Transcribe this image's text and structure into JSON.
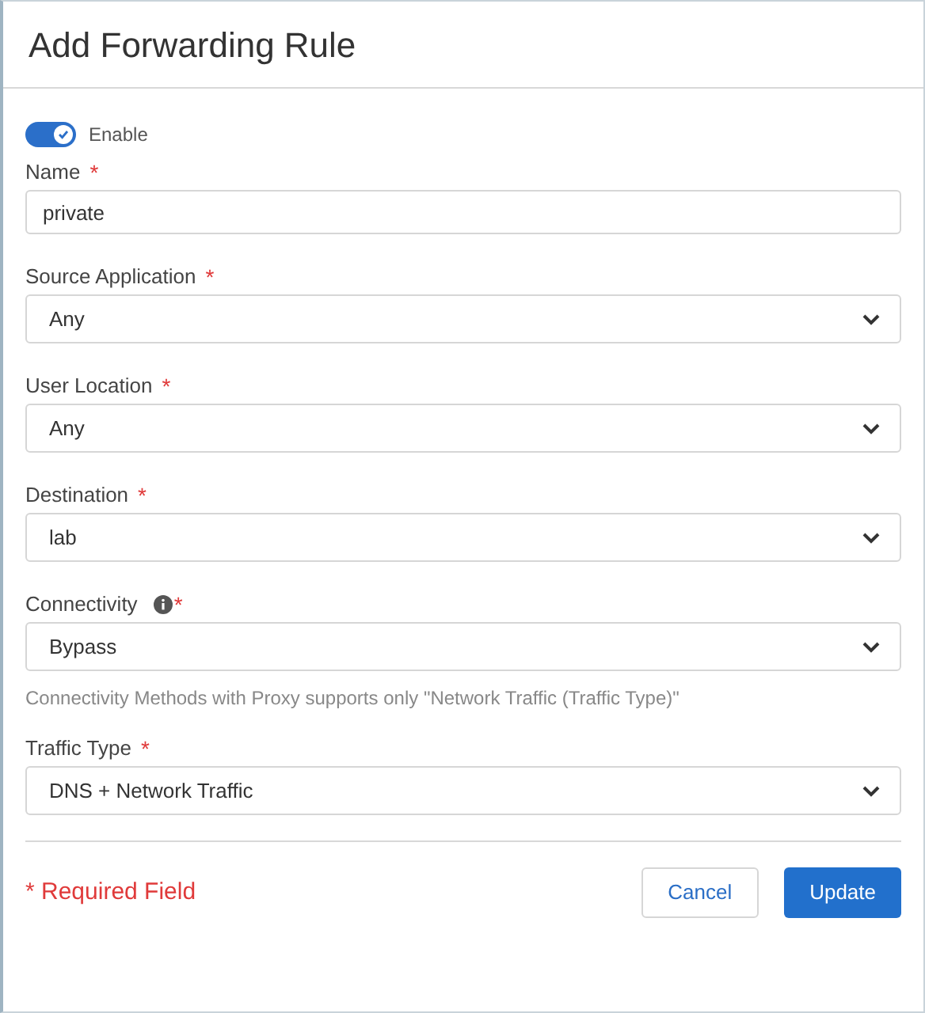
{
  "dialog": {
    "title": "Add Forwarding Rule"
  },
  "enable": {
    "label": "Enable",
    "on": true
  },
  "fields": [
    {
      "kind": "text",
      "label": "Name",
      "required_mark": "*",
      "info": false,
      "value": "private"
    },
    {
      "kind": "select",
      "label": "Source Application",
      "required_mark": "*",
      "info": false,
      "value": "Any"
    },
    {
      "kind": "select",
      "label": "User Location",
      "required_mark": "*",
      "info": false,
      "value": "Any"
    },
    {
      "kind": "select",
      "label": "Destination",
      "required_mark": "*",
      "info": false,
      "value": "lab"
    },
    {
      "kind": "select",
      "label": "Connectivity",
      "required_mark": "*",
      "info": true,
      "value": "Bypass",
      "hint": "Connectivity Methods with Proxy supports only \"Network Traffic (Traffic Type)\""
    },
    {
      "kind": "select",
      "label": "Traffic Type",
      "required_mark": "*",
      "info": false,
      "value": "DNS + Network Traffic"
    }
  ],
  "footer": {
    "required_note": "* Required Field",
    "buttons": [
      {
        "kind": "secondary",
        "label": "Cancel"
      },
      {
        "kind": "primary",
        "label": "Update"
      }
    ]
  }
}
